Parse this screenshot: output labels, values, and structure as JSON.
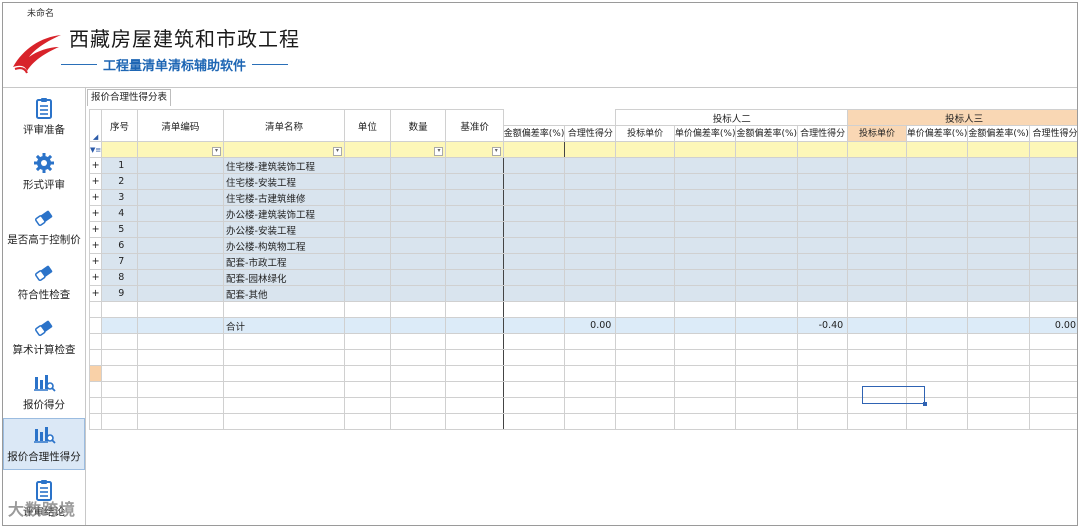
{
  "window": {
    "title": "未命名"
  },
  "app": {
    "title": "西藏房屋建筑和市政工程",
    "subtitle": "工程量清单清标辅助软件"
  },
  "sidebar": {
    "items": [
      {
        "label": "评审准备",
        "icon": "clipboard-icon"
      },
      {
        "label": "形式评审",
        "icon": "gear-icon"
      },
      {
        "label": "是否高于控制价",
        "icon": "eraser-icon"
      },
      {
        "label": "符合性检查",
        "icon": "eraser-icon"
      },
      {
        "label": "算术计算检查",
        "icon": "eraser-icon"
      },
      {
        "label": "报价得分",
        "icon": "bar-chart-search-icon"
      },
      {
        "label": "报价合理性得分",
        "icon": "bar-chart-search-icon",
        "active": true
      },
      {
        "label": "评审结论",
        "icon": "clipboard-icon"
      }
    ]
  },
  "tab": {
    "label": "报价合理性得分表"
  },
  "grid": {
    "groups": {
      "bidder2": "投标人二",
      "bidder3": "投标人三"
    },
    "headers": {
      "seq": "序号",
      "code": "清单编码",
      "name": "清单名称",
      "unit": "单位",
      "qty": "数量",
      "base": "基准价",
      "b1_amount_dev": "金额偏差率(%)",
      "b1_score": "合理性得分",
      "b2_unit_price": "投标单价",
      "b2_unit_dev": "单价偏差率(%)",
      "b2_amount_dev": "金额偏差率(%)",
      "b2_score": "合理性得分",
      "b3_unit_price": "投标单价",
      "b3_unit_dev": "单价偏差率(%)",
      "b3_amount_dev": "金额偏差率(%)",
      "b3_score": "合理性得分"
    },
    "filter_icon": "filter-funnel-icon",
    "rows": [
      {
        "expand": "+",
        "seq": "1",
        "name": "住宅楼-建筑装饰工程"
      },
      {
        "expand": "+",
        "seq": "2",
        "name": "住宅楼-安装工程"
      },
      {
        "expand": "+",
        "seq": "3",
        "name": "住宅楼-古建筑维修"
      },
      {
        "expand": "+",
        "seq": "4",
        "name": "办公楼-建筑装饰工程"
      },
      {
        "expand": "+",
        "seq": "5",
        "name": "办公楼-安装工程"
      },
      {
        "expand": "+",
        "seq": "6",
        "name": "办公楼-构筑物工程"
      },
      {
        "expand": "+",
        "seq": "7",
        "name": "配套-市政工程"
      },
      {
        "expand": "+",
        "seq": "8",
        "name": "配套-园林绿化"
      },
      {
        "expand": "+",
        "seq": "9",
        "name": "配套-其他"
      }
    ],
    "total": {
      "label": "合计",
      "b1_score": "0.00",
      "b2_score": "-0.40",
      "b3_score": "0.00"
    }
  },
  "watermark": "大数跨境"
}
